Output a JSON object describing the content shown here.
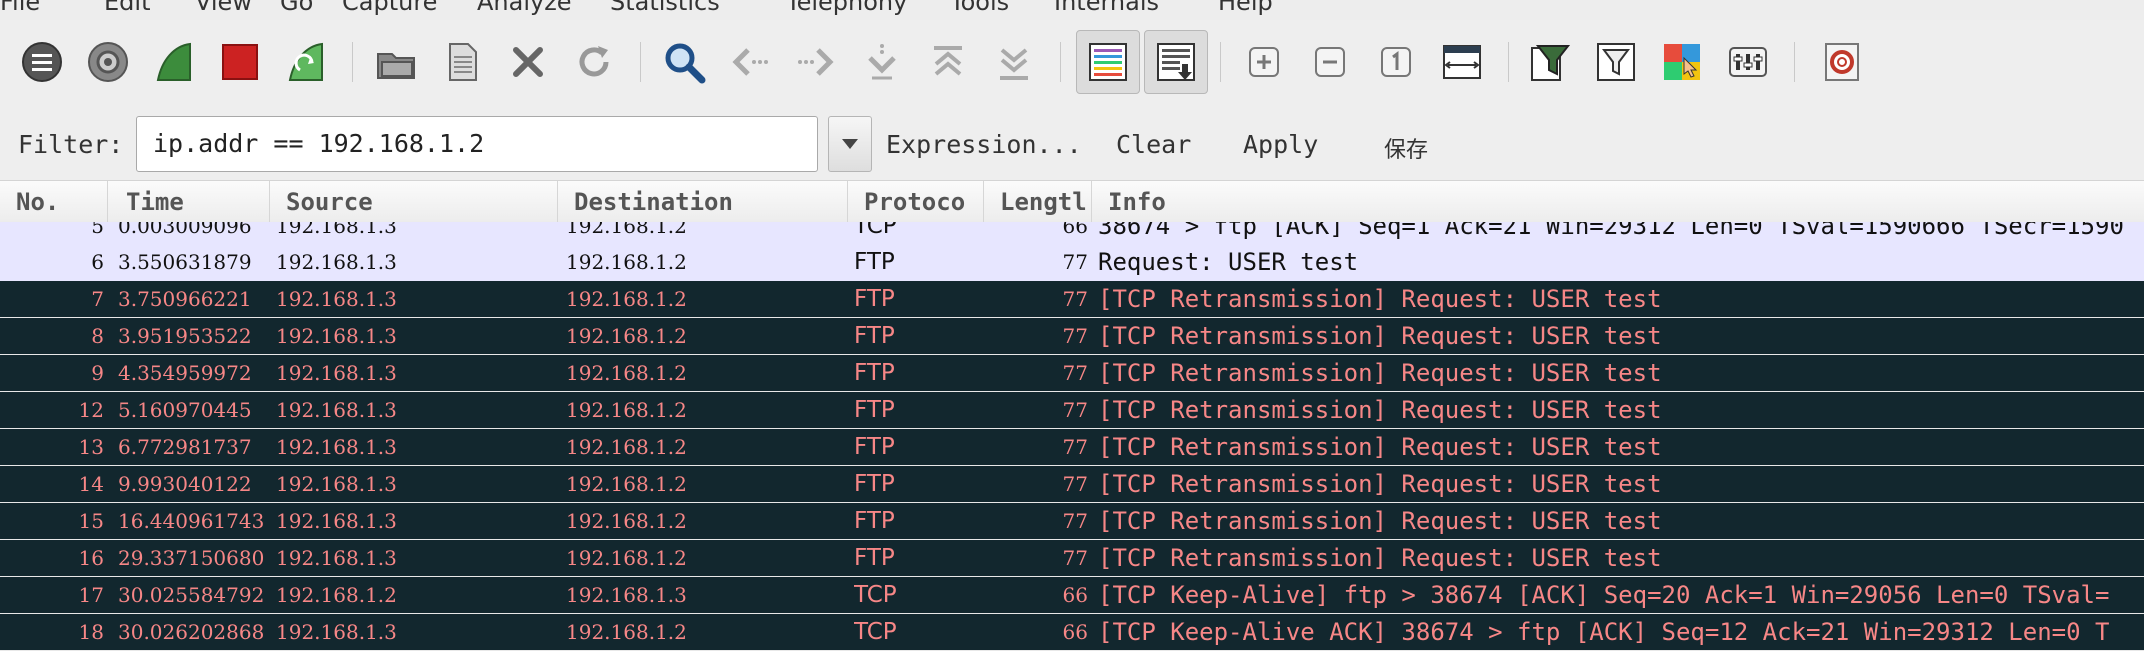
{
  "menu": [
    "File",
    "Edit",
    "View",
    "Go",
    "Capture",
    "Analyze",
    "Statistics",
    "Telephony",
    "Tools",
    "Internals",
    "Help"
  ],
  "toolbar": {
    "icons": [
      "interface-list-icon",
      "capture-options-icon",
      "start-capture-icon",
      "stop-capture-icon",
      "restart-capture-icon",
      "open-file-icon",
      "save-file-icon",
      "close-file-icon",
      "reload-icon",
      "find-packet-icon",
      "go-back-icon",
      "go-forward-icon",
      "go-to-packet-icon",
      "go-first-icon",
      "go-last-icon",
      "colorize-icon",
      "autoscroll-icon",
      "zoom-in-icon",
      "zoom-out-icon",
      "normal-size-icon",
      "resize-columns-icon",
      "capture-filters-icon",
      "display-filters-icon",
      "coloring-rules-icon",
      "preferences-icon",
      "help-icon"
    ]
  },
  "filter": {
    "label": "Filter:",
    "value": "ip.addr == 192.168.1.2",
    "expression": "Expression...",
    "clear": "Clear",
    "apply": "Apply",
    "save": "保存"
  },
  "columns": [
    "No.",
    "Time",
    "Source",
    "Destination",
    "Protoco",
    "Lengtl",
    "Info"
  ],
  "packets": [
    {
      "no": "5",
      "time": "0.003009096",
      "src": "192.168.1.3",
      "dst": "192.168.1.2",
      "proto": "TCP",
      "len": "66",
      "info": "38674 > ftp [ACK] Seq=1 Ack=21 Win=29312 Len=0 TSval=1590666 TSecr=1590",
      "style": "light"
    },
    {
      "no": "6",
      "time": "3.550631879",
      "src": "192.168.1.3",
      "dst": "192.168.1.2",
      "proto": "FTP",
      "len": "77",
      "info": "Request: USER test",
      "style": "light"
    },
    {
      "no": "7",
      "time": "3.750966221",
      "src": "192.168.1.3",
      "dst": "192.168.1.2",
      "proto": "FTP",
      "len": "77",
      "info": "[TCP Retransmission] Request: USER test",
      "style": "dark"
    },
    {
      "no": "8",
      "time": "3.951953522",
      "src": "192.168.1.3",
      "dst": "192.168.1.2",
      "proto": "FTP",
      "len": "77",
      "info": "[TCP Retransmission] Request: USER test",
      "style": "dark"
    },
    {
      "no": "9",
      "time": "4.354959972",
      "src": "192.168.1.3",
      "dst": "192.168.1.2",
      "proto": "FTP",
      "len": "77",
      "info": "[TCP Retransmission] Request: USER test",
      "style": "dark"
    },
    {
      "no": "12",
      "time": "5.160970445",
      "src": "192.168.1.3",
      "dst": "192.168.1.2",
      "proto": "FTP",
      "len": "77",
      "info": "[TCP Retransmission] Request: USER test",
      "style": "dark"
    },
    {
      "no": "13",
      "time": "6.772981737",
      "src": "192.168.1.3",
      "dst": "192.168.1.2",
      "proto": "FTP",
      "len": "77",
      "info": "[TCP Retransmission] Request: USER test",
      "style": "dark"
    },
    {
      "no": "14",
      "time": "9.993040122",
      "src": "192.168.1.3",
      "dst": "192.168.1.2",
      "proto": "FTP",
      "len": "77",
      "info": "[TCP Retransmission] Request: USER test",
      "style": "dark"
    },
    {
      "no": "15",
      "time": "16.440961743",
      "src": "192.168.1.3",
      "dst": "192.168.1.2",
      "proto": "FTP",
      "len": "77",
      "info": "[TCP Retransmission] Request: USER test",
      "style": "dark"
    },
    {
      "no": "16",
      "time": "29.337150680",
      "src": "192.168.1.3",
      "dst": "192.168.1.2",
      "proto": "FTP",
      "len": "77",
      "info": "[TCP Retransmission] Request: USER test",
      "style": "dark"
    },
    {
      "no": "17",
      "time": "30.025584792",
      "src": "192.168.1.2",
      "dst": "192.168.1.3",
      "proto": "TCP",
      "len": "66",
      "info": "[TCP Keep-Alive] ftp > 38674 [ACK] Seq=20 Ack=1 Win=29056 Len=0 TSval=",
      "style": "dark"
    },
    {
      "no": "18",
      "time": "30.026202868",
      "src": "192.168.1.3",
      "dst": "192.168.1.2",
      "proto": "TCP",
      "len": "66",
      "info": "[TCP Keep-Alive ACK] 38674 > ftp [ACK] Seq=12 Ack=21 Win=29312 Len=0 T",
      "style": "dark"
    }
  ],
  "colors": {
    "light_row": "#e7e6ff",
    "dark_row": "#12272e",
    "dark_text": "#f78787"
  }
}
